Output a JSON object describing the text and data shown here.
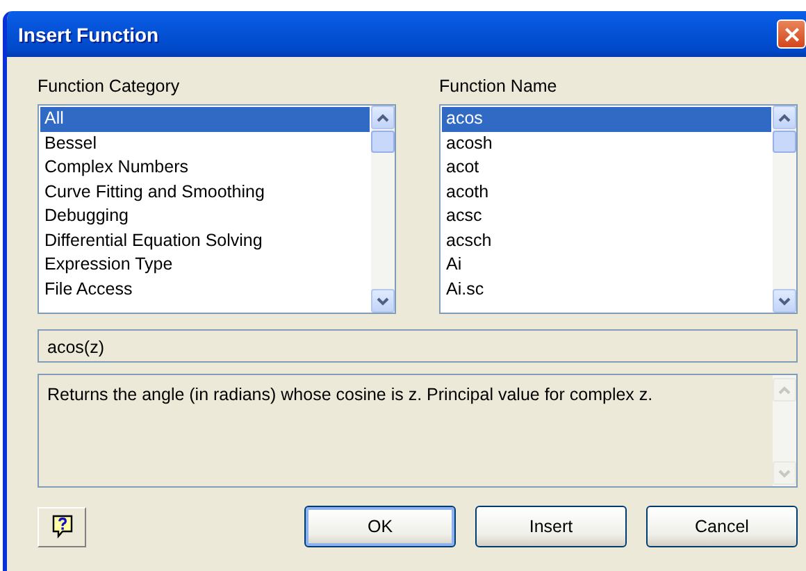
{
  "window": {
    "title": "Insert Function"
  },
  "category_list": {
    "label": "Function Category",
    "items": [
      {
        "text": "All",
        "selected": true
      },
      {
        "text": "Bessel",
        "selected": false
      },
      {
        "text": "Complex Numbers",
        "selected": false
      },
      {
        "text": "Curve Fitting and Smoothing",
        "selected": false
      },
      {
        "text": "Debugging",
        "selected": false
      },
      {
        "text": "Differential Equation Solving",
        "selected": false
      },
      {
        "text": "Expression Type",
        "selected": false
      },
      {
        "text": "File Access",
        "selected": false
      }
    ]
  },
  "name_list": {
    "label": "Function Name",
    "items": [
      {
        "text": "acos",
        "selected": true
      },
      {
        "text": "acosh",
        "selected": false
      },
      {
        "text": "acot",
        "selected": false
      },
      {
        "text": "acoth",
        "selected": false
      },
      {
        "text": "acsc",
        "selected": false
      },
      {
        "text": "acsch",
        "selected": false
      },
      {
        "text": "Ai",
        "selected": false
      },
      {
        "text": "Ai.sc",
        "selected": false
      }
    ]
  },
  "signature": {
    "value": "acos(z)"
  },
  "description": {
    "value": "Returns the angle (in radians) whose cosine is z. Principal value for complex z."
  },
  "buttons": [
    {
      "label": "OK",
      "kind": "default"
    },
    {
      "label": "Insert",
      "kind": "normal"
    },
    {
      "label": "Cancel",
      "kind": "normal"
    }
  ]
}
